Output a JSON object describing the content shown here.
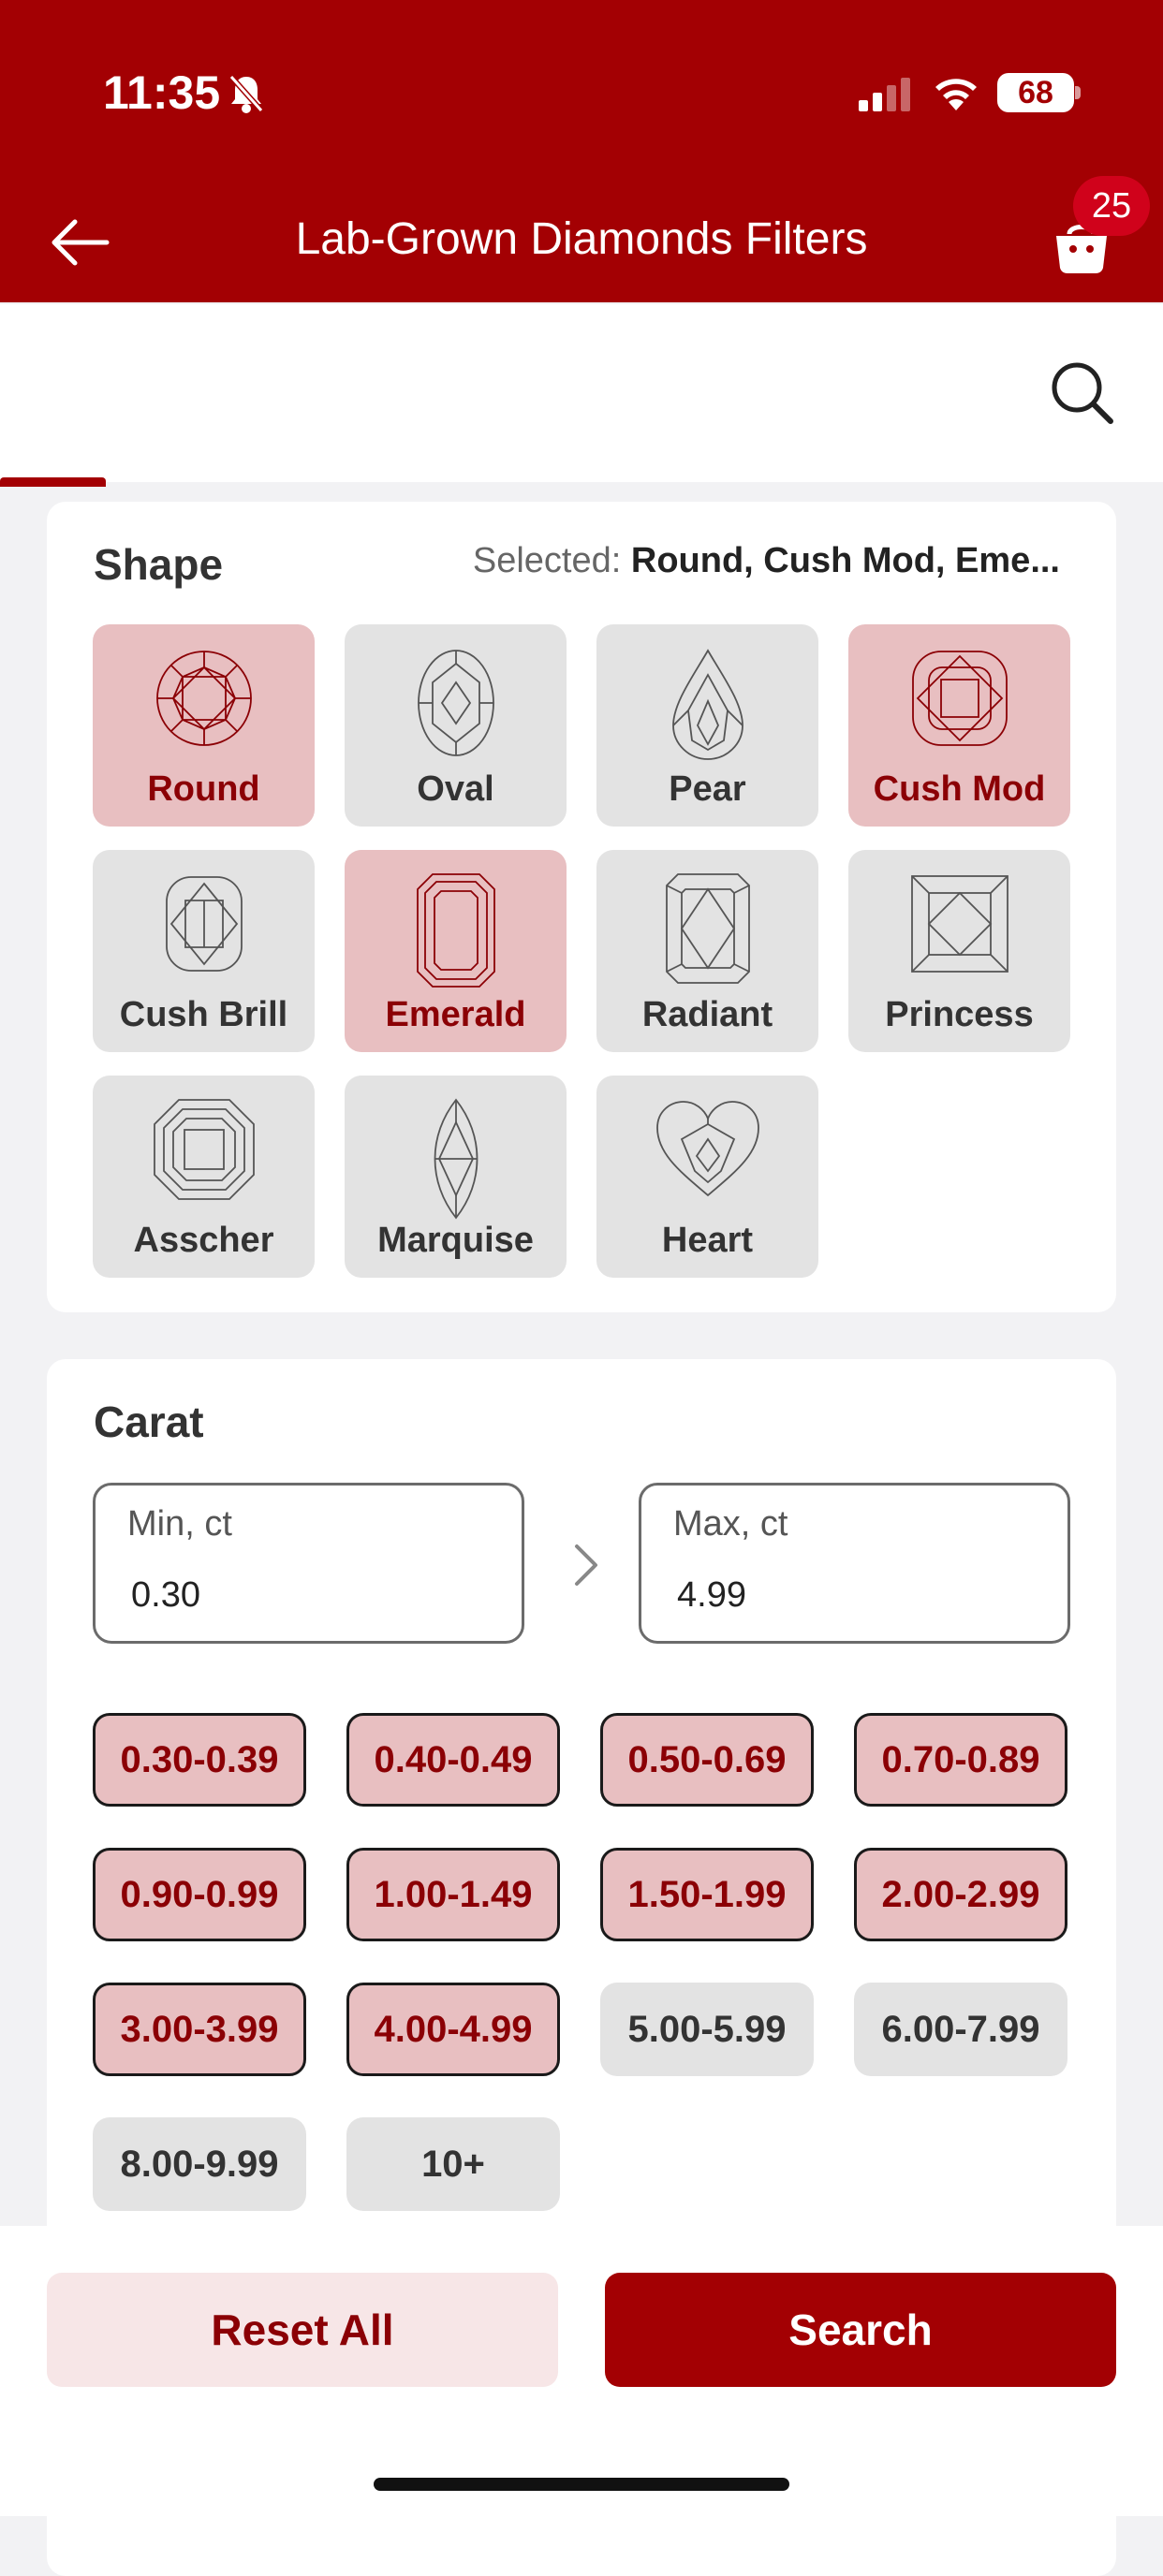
{
  "status_bar": {
    "time": "11:35",
    "battery": "68"
  },
  "header": {
    "title": "Lab-Grown Diamonds Filters",
    "cart_count": "25"
  },
  "shape": {
    "title": "Shape",
    "selected_label": "Selected:",
    "selected_value": "Round, Cush Mod, Eme...",
    "items": [
      {
        "label": "Round",
        "selected": true,
        "icon": "round-diamond-icon"
      },
      {
        "label": "Oval",
        "selected": false,
        "icon": "oval-diamond-icon"
      },
      {
        "label": "Pear",
        "selected": false,
        "icon": "pear-diamond-icon"
      },
      {
        "label": "Cush Mod",
        "selected": true,
        "icon": "cushion-modified-diamond-icon"
      },
      {
        "label": "Cush Brill",
        "selected": false,
        "icon": "cushion-brilliant-diamond-icon"
      },
      {
        "label": "Emerald",
        "selected": true,
        "icon": "emerald-diamond-icon"
      },
      {
        "label": "Radiant",
        "selected": false,
        "icon": "radiant-diamond-icon"
      },
      {
        "label": "Princess",
        "selected": false,
        "icon": "princess-diamond-icon"
      },
      {
        "label": "Asscher",
        "selected": false,
        "icon": "asscher-diamond-icon"
      },
      {
        "label": "Marquise",
        "selected": false,
        "icon": "marquise-diamond-icon"
      },
      {
        "label": "Heart",
        "selected": false,
        "icon": "heart-diamond-icon"
      }
    ]
  },
  "carat": {
    "title": "Carat",
    "min_placeholder": "Min, ct",
    "min_value": "0.30",
    "max_placeholder": "Max, ct",
    "max_value": "4.99",
    "ranges": [
      {
        "label": "0.30-0.39",
        "selected": true
      },
      {
        "label": "0.40-0.49",
        "selected": true
      },
      {
        "label": "0.50-0.69",
        "selected": true
      },
      {
        "label": "0.70-0.89",
        "selected": true
      },
      {
        "label": "0.90-0.99",
        "selected": true
      },
      {
        "label": "1.00-1.49",
        "selected": true
      },
      {
        "label": "1.50-1.99",
        "selected": true
      },
      {
        "label": "2.00-2.99",
        "selected": true
      },
      {
        "label": "3.00-3.99",
        "selected": true
      },
      {
        "label": "4.00-4.99",
        "selected": true
      },
      {
        "label": "5.00-5.99",
        "selected": false
      },
      {
        "label": "6.00-7.99",
        "selected": false
      },
      {
        "label": "8.00-9.99",
        "selected": false
      },
      {
        "label": "10+",
        "selected": false
      }
    ]
  },
  "footer": {
    "reset_label": "Reset All",
    "search_label": "Search"
  },
  "colors": {
    "brand": "#a30003",
    "selected_bg": "#e8bfc1",
    "selected_text": "#8b0005",
    "tile_bg": "#e3e3e3"
  }
}
